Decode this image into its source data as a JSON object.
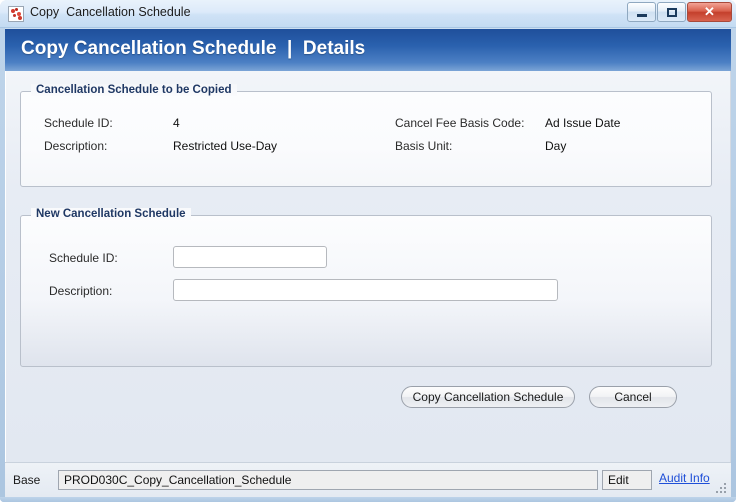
{
  "window": {
    "title": "Copy  Cancellation Schedule",
    "icon": "app-berries-icon",
    "controls": {
      "minimize_label": "Minimize",
      "restore_label": "Restore",
      "close_label": "✕"
    }
  },
  "header": {
    "title": "Copy Cancellation Schedule  |  Details"
  },
  "sections": {
    "copied": {
      "legend": "Cancellation Schedule to be Copied",
      "fields": [
        {
          "label": "Schedule ID:",
          "value": "4"
        },
        {
          "label": "Description:",
          "value": "Restricted Use-Day"
        },
        {
          "label": "Cancel Fee Basis Code:",
          "value": "Ad Issue Date"
        },
        {
          "label": "Basis Unit:",
          "value": "Day"
        }
      ]
    },
    "new_schedule": {
      "legend": "New Cancellation Schedule",
      "fields": [
        {
          "label": "Schedule ID:",
          "value": "",
          "placeholder": ""
        },
        {
          "label": "Description:",
          "value": "",
          "placeholder": ""
        }
      ],
      "buttons": {
        "primary": "Copy Cancellation Schedule",
        "secondary": "Cancel"
      }
    }
  },
  "statusbar": {
    "base_label": "Base",
    "base_value": "PROD030C_Copy_Cancellation_Schedule",
    "edit_label": "Edit",
    "audit_label": "Audit Info"
  },
  "colors": {
    "header_blue": "#2a61ae",
    "legend_navy": "#1f3864",
    "link_blue": "#1f4fd8",
    "close_red": "#c4402c",
    "content_bg": "#e2e8f1"
  }
}
